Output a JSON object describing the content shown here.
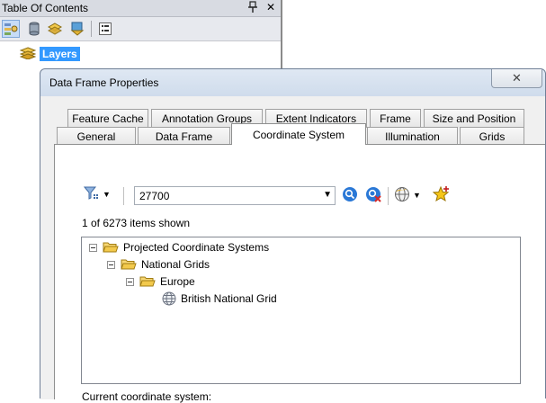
{
  "toc": {
    "title": "Table Of Contents",
    "pin_glyph": "♂",
    "close_glyph": "✕",
    "toolbar": [
      {
        "icon": "list-by-drawing-order-icon",
        "active": true
      },
      {
        "icon": "list-by-source-icon"
      },
      {
        "icon": "list-by-visibility-icon"
      },
      {
        "icon": "list-by-selection-icon"
      },
      {
        "icon": "options-icon"
      }
    ],
    "layers_label": "Layers"
  },
  "dialog": {
    "title": "Data Frame Properties",
    "close_glyph": "✕",
    "tabs_row1": [
      "Feature Cache",
      "Annotation Groups",
      "Extent Indicators",
      "Frame",
      "Size and Position"
    ],
    "tabs_row2": [
      "General",
      "Data Frame",
      "Coordinate System",
      "Illumination",
      "Grids"
    ],
    "selected_tab": "Coordinate System",
    "search": {
      "value": "27700",
      "dropdown_glyph": "▼",
      "filter_dropdown_glyph": "▼"
    },
    "items_shown": "1 of 6273 items shown",
    "tree": [
      {
        "label": "Projected Coordinate Systems",
        "type": "folder",
        "expanded": true,
        "level": 0
      },
      {
        "label": "National Grids",
        "type": "folder",
        "expanded": true,
        "level": 1
      },
      {
        "label": "Europe",
        "type": "folder",
        "expanded": true,
        "level": 2
      },
      {
        "label": "British National Grid",
        "type": "coordinate-system",
        "level": 3
      }
    ],
    "current_cs_label": "Current coordinate system:"
  },
  "colors": {
    "selection_blue": "#3399ff",
    "folder_yellow": "#f2c94c",
    "search_blue": "#2a78d6"
  }
}
